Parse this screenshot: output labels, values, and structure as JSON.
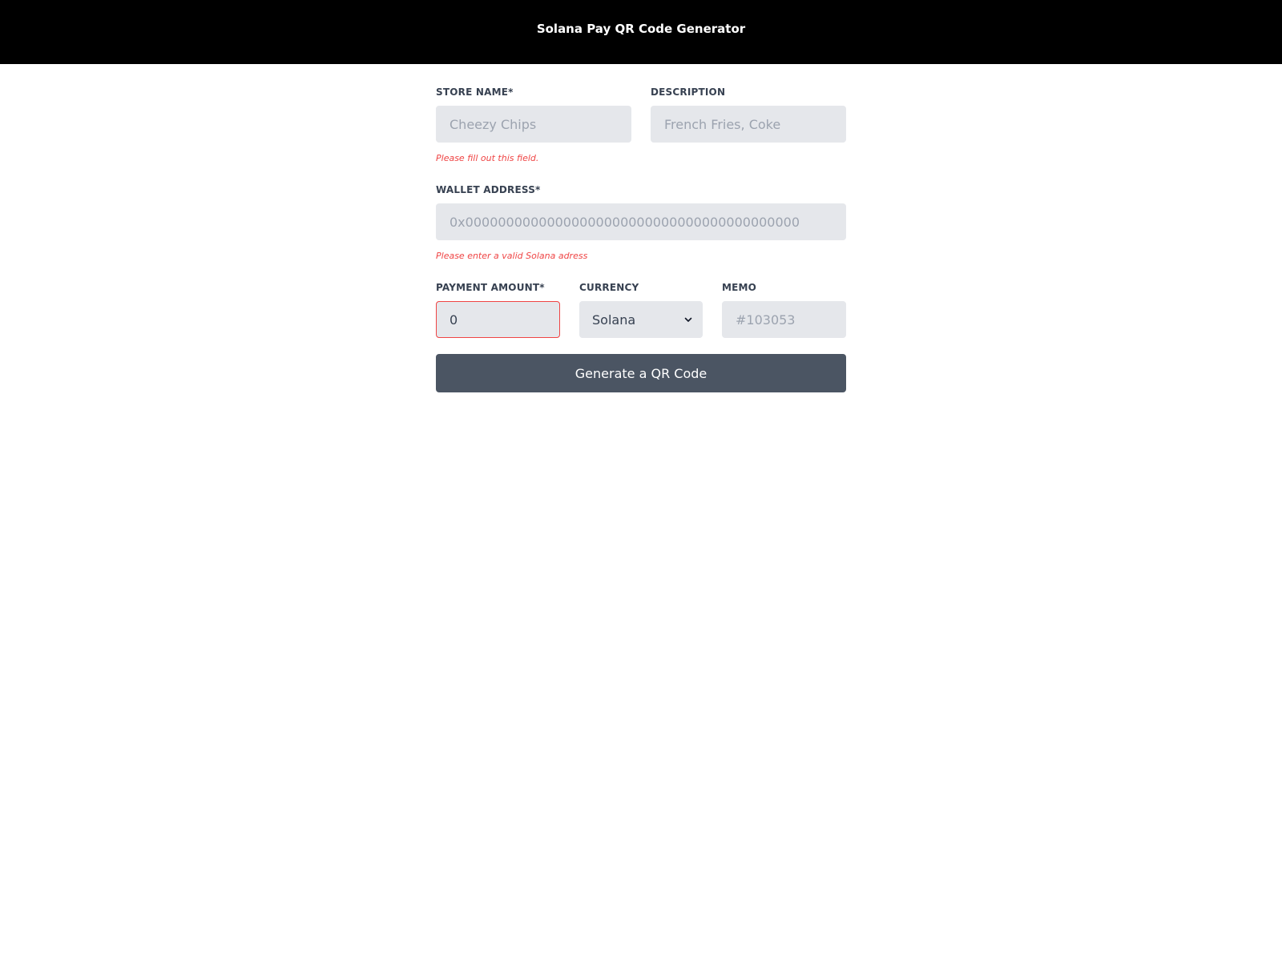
{
  "header": {
    "title": "Solana Pay QR Code Generator"
  },
  "form": {
    "store_name": {
      "label": "STORE NAME*",
      "placeholder": "Cheezy Chips",
      "value": "",
      "error": "Please fill out this field."
    },
    "description": {
      "label": "DESCRIPTION",
      "placeholder": "French Fries, Coke",
      "value": ""
    },
    "wallet_address": {
      "label": "WALLET ADDRESS*",
      "placeholder": "0x00000000000000000000000000000000000000000",
      "value": "",
      "error": "Please enter a valid Solana adress"
    },
    "payment_amount": {
      "label": "PAYMENT AMOUNT*",
      "value": "0"
    },
    "currency": {
      "label": "CURRENCY",
      "selected": "Solana"
    },
    "memo": {
      "label": "MEMO",
      "placeholder": "#103053",
      "value": ""
    },
    "submit_label": "Generate a QR Code"
  },
  "colors": {
    "header_bg": "#000000",
    "field_bg": "#e5e7eb",
    "error": "#ef4444",
    "button_bg": "#4b5563"
  },
  "icons": {
    "currency_select": "chevron-down-icon"
  }
}
